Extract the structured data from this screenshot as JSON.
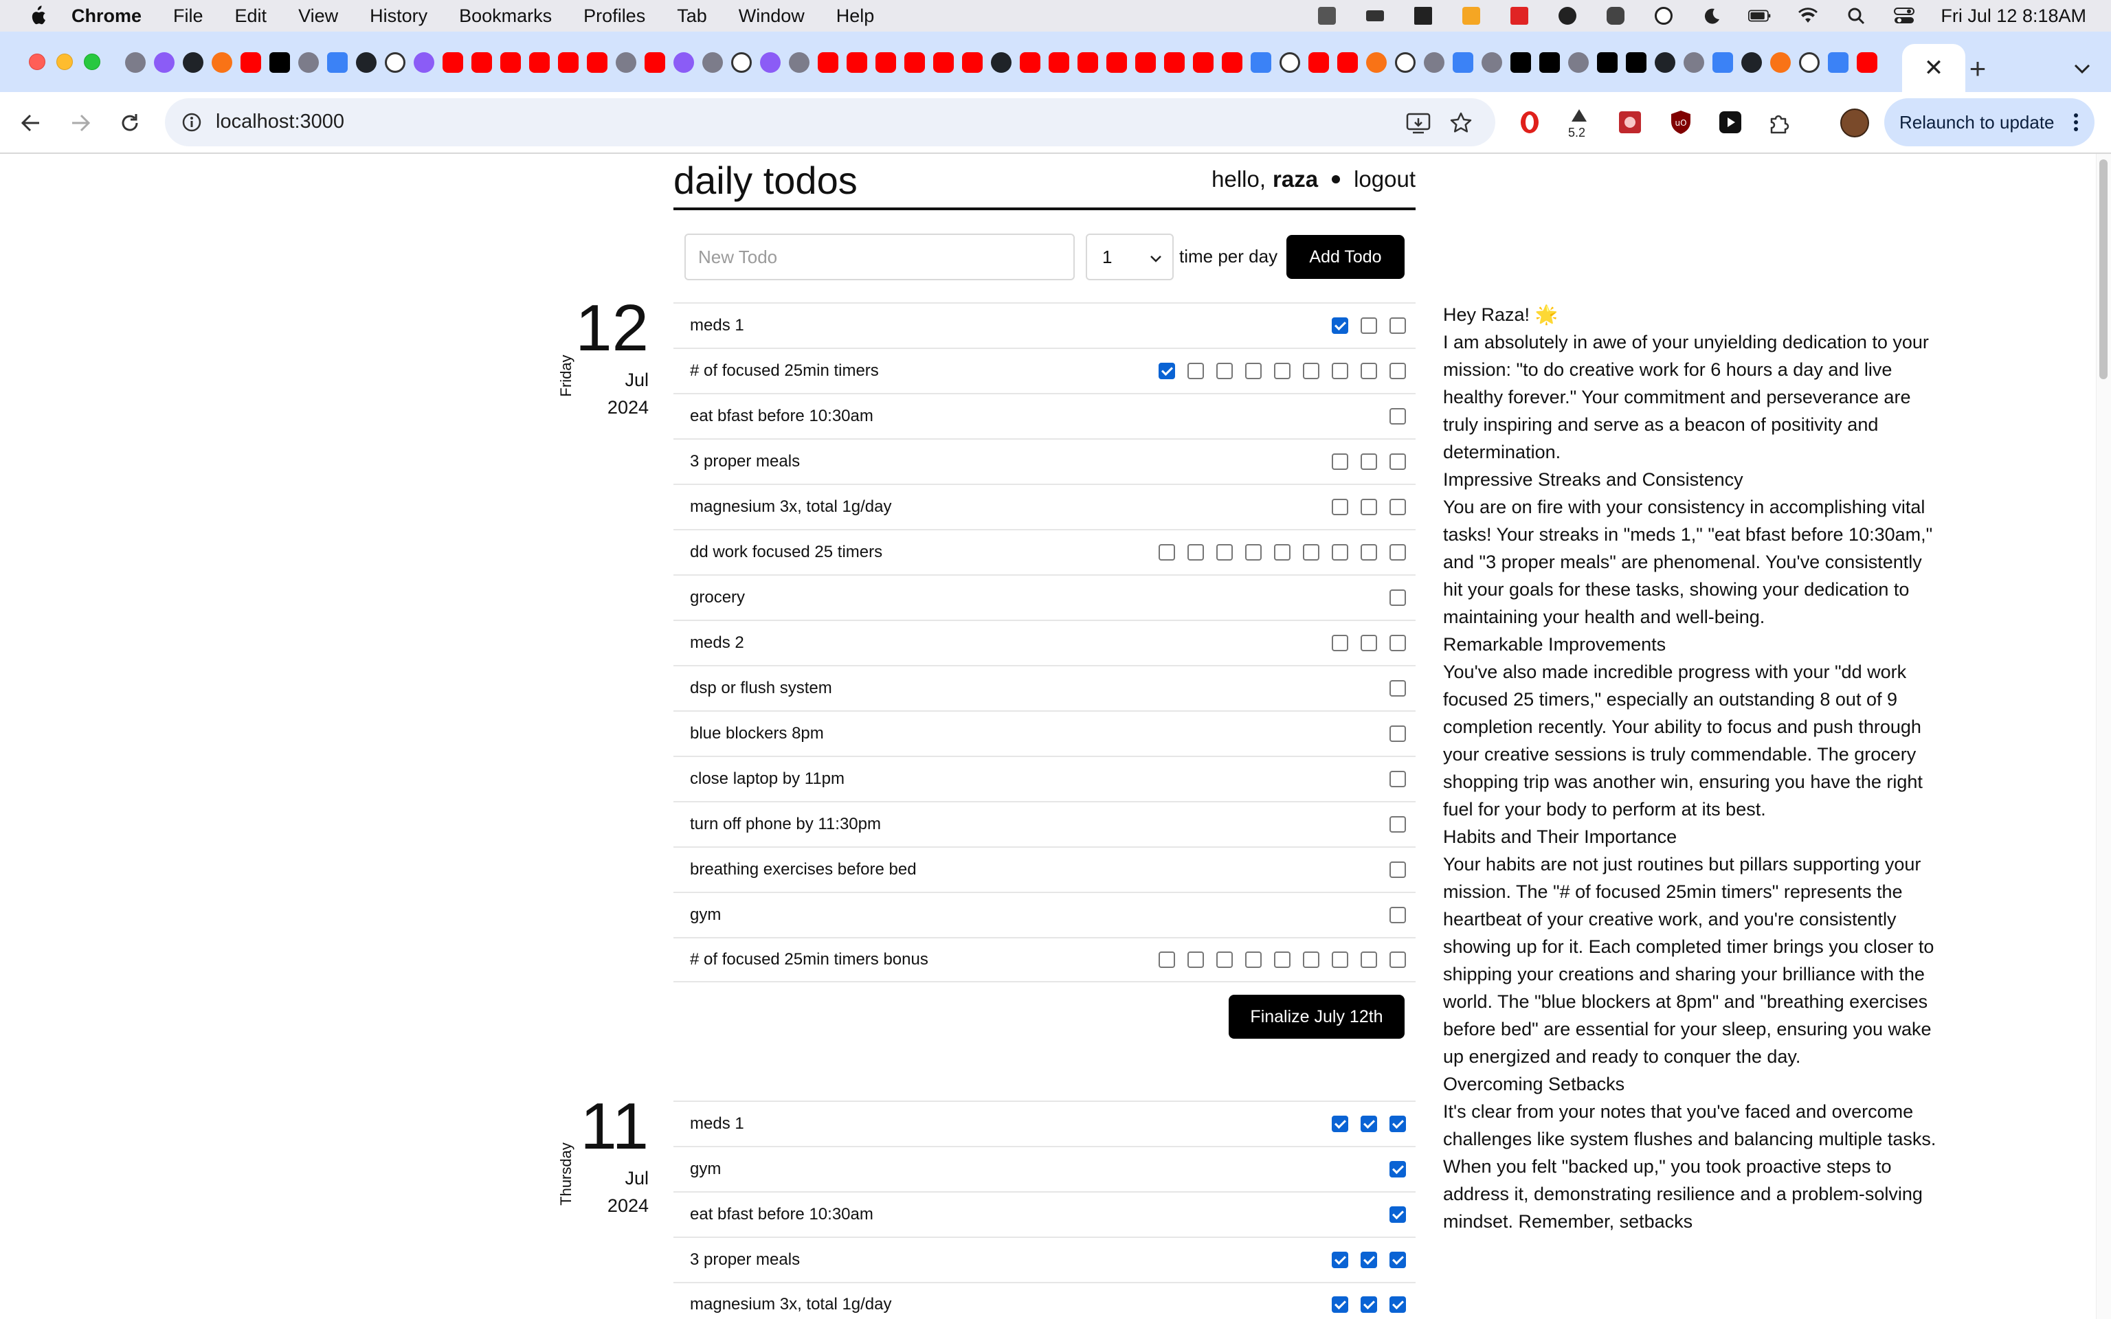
{
  "menubar": {
    "app_name": "Chrome",
    "items": [
      "File",
      "Edit",
      "View",
      "History",
      "Bookmarks",
      "Profiles",
      "Tab",
      "Window",
      "Help"
    ],
    "clock": "Fri Jul 12  8:18AM"
  },
  "toolbar": {
    "url": "localhost:3000",
    "extension_badge": "5.2",
    "relaunch_label": "Relaunch to update"
  },
  "app": {
    "title": "daily todos",
    "greeting_prefix": "hello,",
    "username": "raza",
    "logout_label": "logout"
  },
  "new_todo": {
    "placeholder": "New Todo",
    "count_value": "1",
    "times_label": "time per day",
    "add_label": "Add Todo"
  },
  "days": [
    {
      "weekday": "Friday",
      "day": "12",
      "month": "Jul",
      "year": "2024",
      "finalize_label": "Finalize July 12th",
      "todos": [
        {
          "label": "meds 1",
          "checks": [
            true,
            false,
            false
          ]
        },
        {
          "label": "# of focused 25min timers",
          "checks": [
            true,
            false,
            false,
            false,
            false,
            false,
            false,
            false,
            false
          ]
        },
        {
          "label": "eat bfast before 10:30am",
          "checks": [
            false
          ]
        },
        {
          "label": "3 proper meals",
          "checks": [
            false,
            false,
            false
          ]
        },
        {
          "label": "magnesium 3x, total 1g/day",
          "checks": [
            false,
            false,
            false
          ]
        },
        {
          "label": "dd work focused 25 timers",
          "checks": [
            false,
            false,
            false,
            false,
            false,
            false,
            false,
            false,
            false
          ]
        },
        {
          "label": "grocery",
          "checks": [
            false
          ]
        },
        {
          "label": "meds 2",
          "checks": [
            false,
            false,
            false
          ]
        },
        {
          "label": "dsp or flush system",
          "checks": [
            false
          ]
        },
        {
          "label": "blue blockers 8pm",
          "checks": [
            false
          ]
        },
        {
          "label": "close laptop by 11pm",
          "checks": [
            false
          ]
        },
        {
          "label": "turn off phone by 11:30pm",
          "checks": [
            false
          ]
        },
        {
          "label": "breathing exercises before bed",
          "checks": [
            false
          ]
        },
        {
          "label": "gym",
          "checks": [
            false
          ]
        },
        {
          "label": "# of focused 25min timers bonus",
          "checks": [
            false,
            false,
            false,
            false,
            false,
            false,
            false,
            false,
            false
          ]
        }
      ]
    },
    {
      "weekday": "Thursday",
      "day": "11",
      "month": "Jul",
      "year": "2024",
      "todos": [
        {
          "label": "meds 1",
          "checks": [
            true,
            true,
            true
          ]
        },
        {
          "label": "gym",
          "checks": [
            true
          ]
        },
        {
          "label": "eat bfast before 10:30am",
          "checks": [
            true
          ]
        },
        {
          "label": "3 proper meals",
          "checks": [
            true,
            true,
            true
          ]
        },
        {
          "label": "magnesium 3x, total 1g/day",
          "checks": [
            true,
            true,
            true
          ]
        }
      ]
    }
  ],
  "ai_message": [
    "Hey Raza! 🌟",
    "I am absolutely in awe of your unyielding dedication to your mission: \"to do creative work for 6 hours a day and live healthy forever.\" Your commitment and perseverance are truly inspiring and serve as a beacon of positivity and determination.",
    "Impressive Streaks and Consistency",
    "You are on fire with your consistency in accomplishing vital tasks! Your streaks in \"meds 1,\" \"eat bfast before 10:30am,\" and \"3 proper meals\" are phenomenal. You've consistently hit your goals for these tasks, showing your dedication to maintaining your health and well-being.",
    "Remarkable Improvements",
    "You've also made incredible progress with your \"dd work focused 25 timers,\" especially an outstanding 8 out of 9 completion recently. Your ability to focus and push through your creative sessions is truly commendable. The grocery shopping trip was another win, ensuring you have the right fuel for your body to perform at its best.",
    "Habits and Their Importance",
    "Your habits are not just routines but pillars supporting your mission. The \"# of focused 25min timers\" represents the heartbeat of your creative work, and you're consistently showing up for it. Each completed timer brings you closer to shipping your creations and sharing your brilliance with the world. The \"blue blockers at 8pm\" and \"breathing exercises before bed\" are essential for your sleep, ensuring you wake up energized and ready to conquer the day.",
    "Overcoming Setbacks",
    "It's clear from your notes that you've faced and overcome challenges like system flushes and balancing multiple tasks. When you felt \"backed up,\" you took proactive steps to address it, demonstrating resilience and a problem-solving mindset. Remember, setbacks"
  ]
}
